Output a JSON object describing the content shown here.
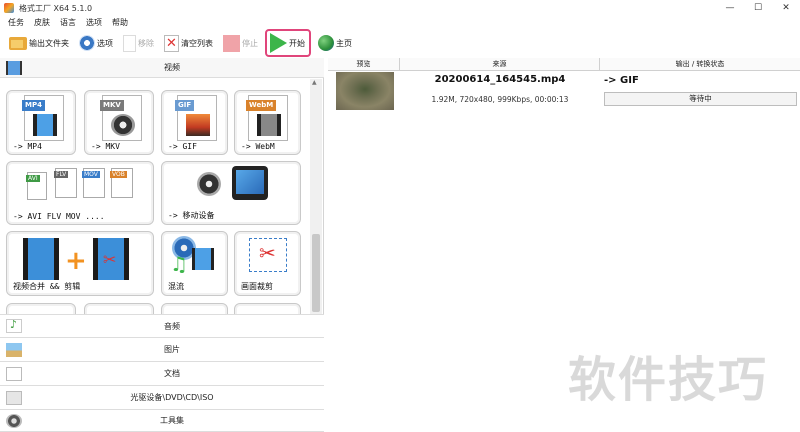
{
  "window": {
    "title": "格式工厂 X64 5.1.0",
    "minimize": "—",
    "maximize": "☐",
    "close": "✕"
  },
  "menu": [
    "任务",
    "皮肤",
    "语言",
    "选项",
    "帮助"
  ],
  "toolbar": {
    "output_folder": "输出文件夹",
    "options": "选项",
    "remove": "移除",
    "clear_list": "清空列表",
    "stop": "停止",
    "start": "开始",
    "home": "主页"
  },
  "categories": {
    "video": "视频",
    "audio": "音频",
    "picture": "图片",
    "document": "文档",
    "disc": "光驱设备\\DVD\\CD\\ISO",
    "tools": "工具集"
  },
  "tiles": [
    {
      "label": "-> MP4",
      "badge": "MP4",
      "badge_color": "#3a7dc9"
    },
    {
      "label": "-> MKV",
      "badge": "MKV",
      "badge_color": "#7a7a7a"
    },
    {
      "label": "-> GIF",
      "badge": "GIF",
      "badge_color": "#6a9bd1"
    },
    {
      "label": "-> WebM",
      "badge": "WebM",
      "badge_color": "#d9822b"
    },
    {
      "label": "-> AVI FLV MOV ....",
      "badges": [
        "AVI",
        "FLV",
        "MOV",
        "VOB"
      ]
    },
    {
      "label": "-> 移动设备"
    },
    {
      "label": "视频合并 && 剪辑"
    },
    {
      "label": "混流"
    },
    {
      "label": "画面裁剪"
    }
  ],
  "table": {
    "headers": [
      "预览",
      "来源",
      "输出 / 转换状态"
    ],
    "rows": [
      {
        "filename": "20200614_164545.mp4",
        "info": "1.92M, 720x480, 999Kbps, 00:00:13",
        "target": "-> GIF",
        "status": "等待中"
      }
    ]
  },
  "watermark": "软件技巧",
  "colors": {
    "start_highlight": "#e0457b",
    "play_green": "#3cb54a"
  }
}
